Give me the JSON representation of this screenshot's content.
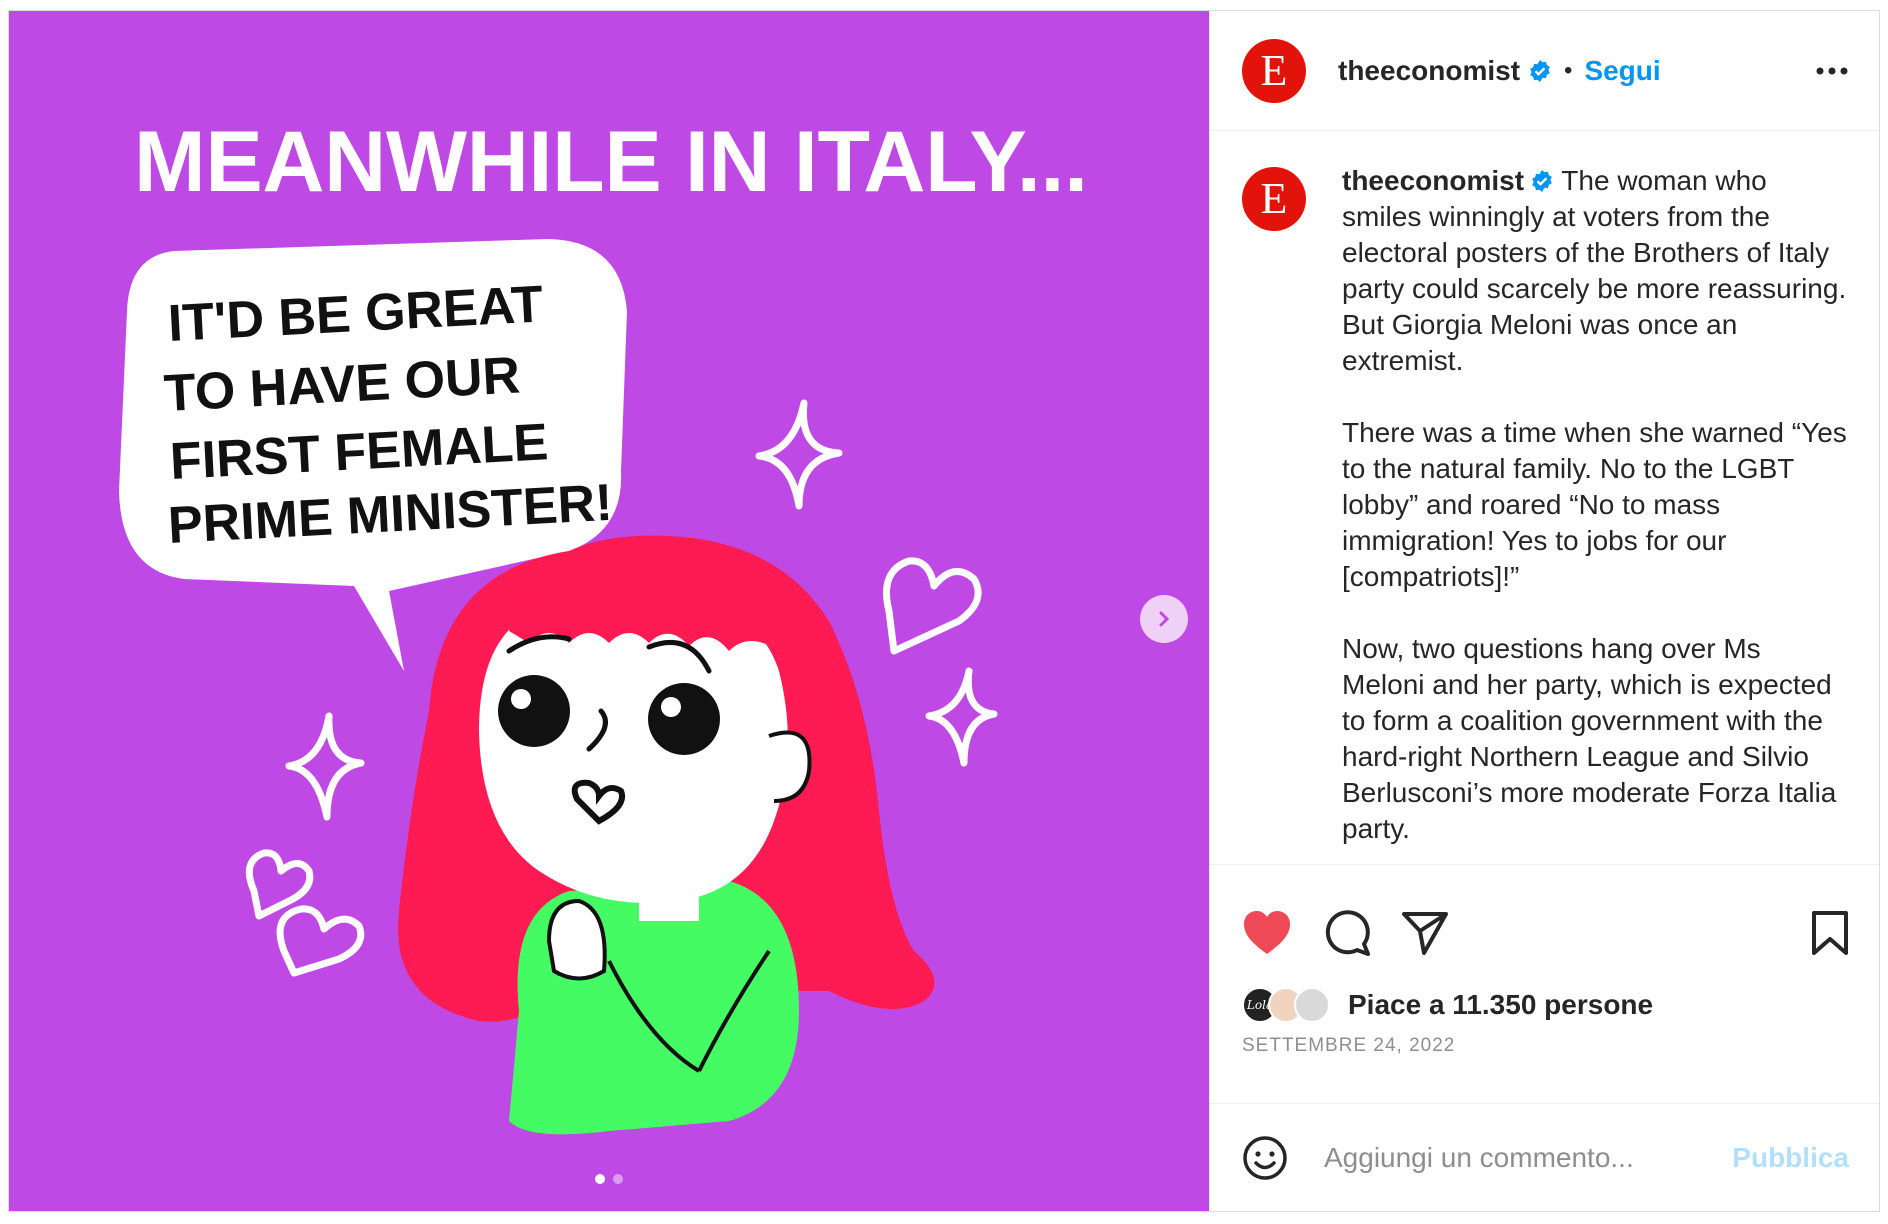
{
  "post": {
    "image_text": {
      "headline": "MEANWHILE IN ITALY...",
      "bubble_line1": "IT'D BE GREAT",
      "bubble_line2": "TO HAVE OUR",
      "bubble_line3": "FIRST FEMALE",
      "bubble_line4": "PRIME MINISTER!"
    },
    "carousel": {
      "total": 2,
      "current": 1
    }
  },
  "header": {
    "logo_letter": "E",
    "username": "theeconomist",
    "separator": "•",
    "follow_label": "Segui",
    "more_icon": "more-horizontal-icon"
  },
  "caption": {
    "username": "theeconomist",
    "text": " The woman who smiles winningly at voters from the electoral posters of the Brothers of Italy party could scarcely be more reassuring. But Giorgia Meloni was once an extremist.\n\nThere was a time when she warned “Yes to the natural family. No to the LGBT lobby” and roared “No to mass immigration! Yes to jobs for our [compatriots]!”\n\nNow, two questions hang over Ms Meloni and her party, which is expected to form a coalition government with the hard-right Northern League and Silvio Berlusconi’s more moderate Forza Italia party."
  },
  "actions": {
    "icons": [
      "heart-filled-icon",
      "comment-icon",
      "share-icon",
      "bookmark-icon"
    ],
    "liked": true,
    "like_color": "#ed4956"
  },
  "likes": {
    "text": "Piace a 11.350 persone",
    "avatar1_label": "Lola"
  },
  "date": "SETTEMBRE 24, 2022",
  "comment": {
    "placeholder": "Aggiungi un commento...",
    "publish_label": "Pubblica"
  },
  "colors": {
    "background_purple": "#bf49e4",
    "hair_red": "#fe1a52",
    "sweater_green": "#45fb63",
    "brand_red": "#e3120b",
    "link_blue": "#0095f6"
  }
}
